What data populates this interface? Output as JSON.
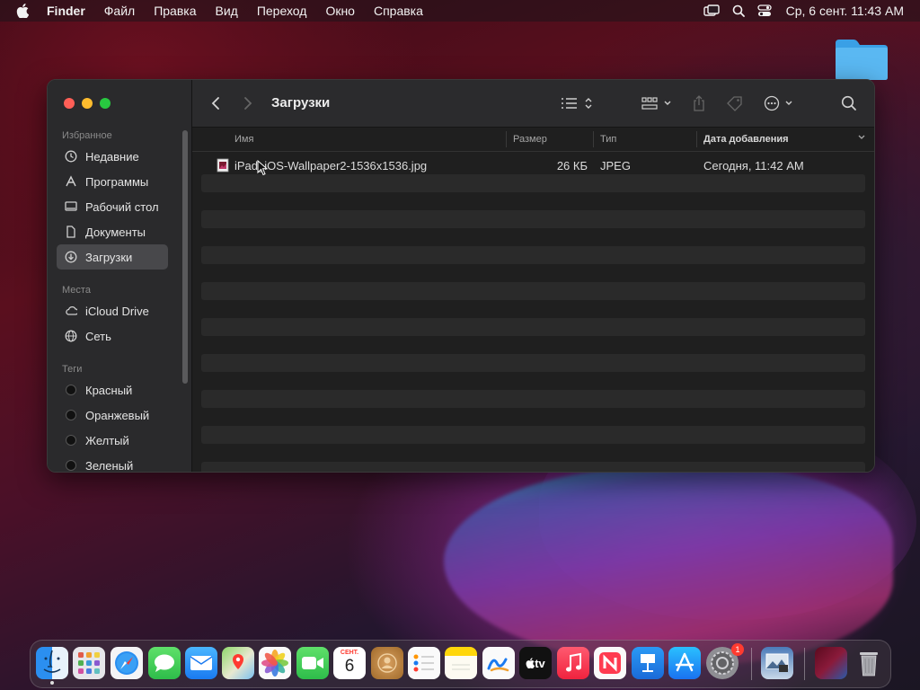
{
  "menubar": {
    "app": "Finder",
    "items": [
      "Файл",
      "Правка",
      "Вид",
      "Переход",
      "Окно",
      "Справка"
    ],
    "clock": "Ср, 6 сент.  11:43 AM"
  },
  "window": {
    "title": "Загрузки",
    "sidebar": {
      "favorites_title": "Избранное",
      "favorites": [
        {
          "label": "Недавние",
          "icon": "clock-icon"
        },
        {
          "label": "Программы",
          "icon": "applications-icon"
        },
        {
          "label": "Рабочий стол",
          "icon": "desktop-icon"
        },
        {
          "label": "Документы",
          "icon": "document-icon"
        },
        {
          "label": "Загрузки",
          "icon": "download-icon",
          "selected": true
        }
      ],
      "locations_title": "Места",
      "locations": [
        {
          "label": "iCloud Drive",
          "icon": "cloud-icon"
        },
        {
          "label": "Сеть",
          "icon": "network-icon"
        }
      ],
      "tags_title": "Теги",
      "tags": [
        {
          "label": "Красный"
        },
        {
          "label": "Оранжевый"
        },
        {
          "label": "Желтый"
        },
        {
          "label": "Зеленый"
        }
      ]
    },
    "columns": {
      "name": "Имя",
      "size": "Размер",
      "kind": "Тип",
      "date_added": "Дата добавления"
    },
    "files": [
      {
        "name": "iPad_iOS-Wallpaper2-1536x1536.jpg",
        "size": "26 КБ",
        "kind": "JPEG",
        "date_added": "Сегодня, 11:42 AM"
      }
    ]
  },
  "dock": {
    "calendar_month": "СЕНТ.",
    "calendar_day": "6",
    "settings_badge": "1",
    "tv_label": "tv"
  }
}
